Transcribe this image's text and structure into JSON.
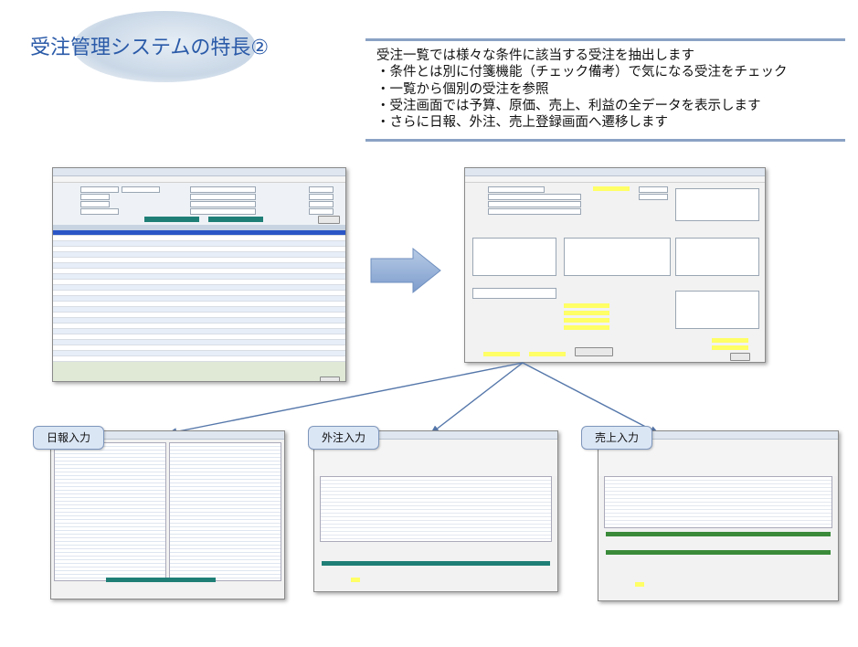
{
  "slide": {
    "title": "受注管理システムの特長②",
    "bullets": [
      "受注一覧では様々な条件に該当する受注を抽出します",
      "・条件とは別に付箋機能（チェック備考）で気になる受注をチェック",
      "・一覧から個別の受注を参照",
      "・受注画面では予算、原価、売上、利益の全データを表示します",
      "・さらに日報、外注、売上登録画面へ遷移します"
    ],
    "labels": {
      "nippo": "日報入力",
      "gaichu": "外注入力",
      "uriage": "売上入力"
    }
  },
  "colors": {
    "title": "#2a5aa8",
    "rule": "#8aa2c4",
    "selected_row": "#2a56c6",
    "teal": "#1f7f77",
    "label_bg": "#dbe6f5"
  },
  "icons": [
    "right-arrow-icon",
    "connector-line-icon"
  ]
}
